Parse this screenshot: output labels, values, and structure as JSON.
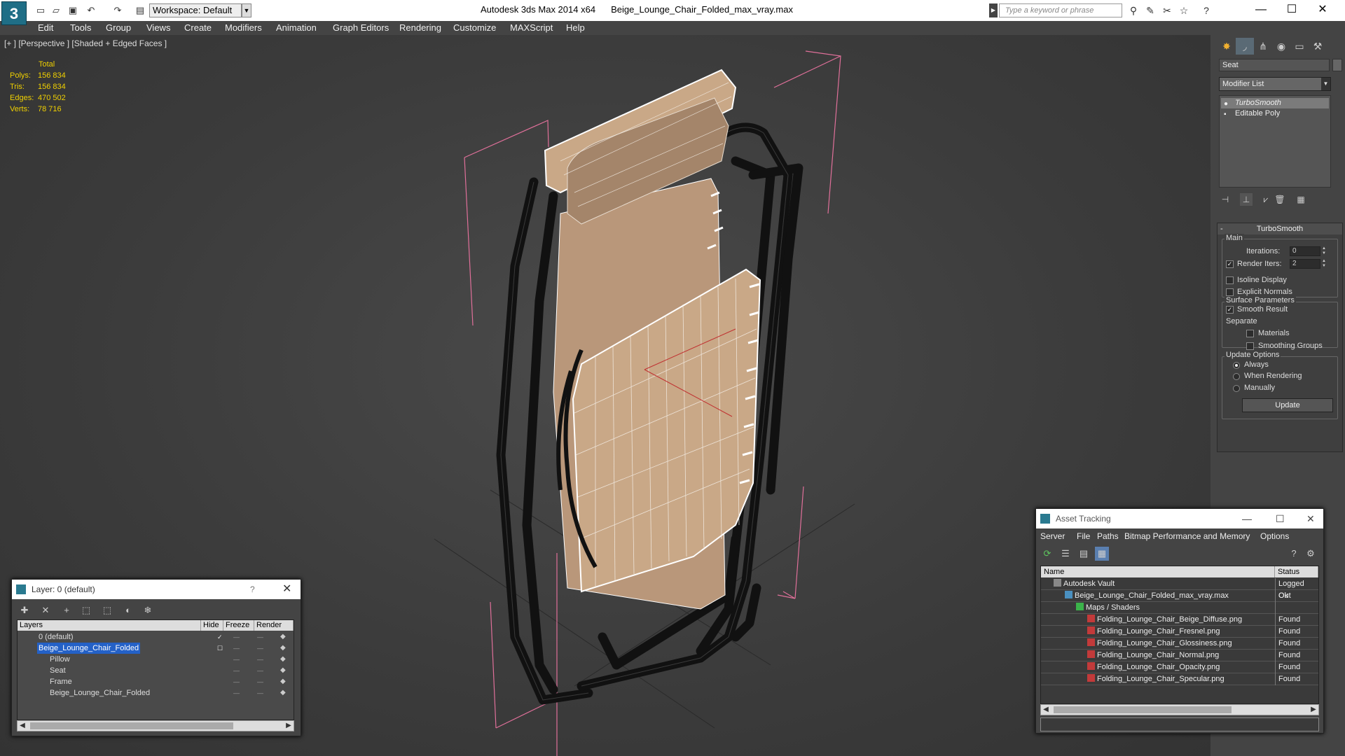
{
  "app": {
    "window_title": "Autodesk 3ds Max  2014 x64",
    "file_title": "Beige_Lounge_Chair_Folded_max_vray.max",
    "logo": "3",
    "workspace": "Workspace: Default",
    "search_placeholder": "Type a keyword or phrase"
  },
  "menu": [
    "Edit",
    "Tools",
    "Group",
    "Views",
    "Create",
    "Modifiers",
    "Animation",
    "Graph Editors",
    "Rendering",
    "Customize",
    "MAXScript",
    "Help"
  ],
  "viewport": {
    "label": "[+ ] [Perspective ] [Shaded + Edged Faces ]",
    "stats": {
      "header": "Total",
      "rows": [
        {
          "label": "Polys:",
          "value": "156 834"
        },
        {
          "label": "Tris:",
          "value": "156 834"
        },
        {
          "label": "Edges:",
          "value": "470 502"
        },
        {
          "label": "Verts:",
          "value": "78 716"
        }
      ]
    }
  },
  "command_panel": {
    "object_name": "Seat",
    "modifier_list": "Modifier List",
    "stack": [
      {
        "label": "TurboSmooth",
        "selected": true
      },
      {
        "label": "Editable Poly",
        "selected": false
      }
    ],
    "rollout_title": "TurboSmooth",
    "main_group": "Main",
    "iterations_label": "Iterations:",
    "iterations_value": "0",
    "render_iters_label": "Render Iters:",
    "render_iters_value": "2",
    "isoline_label": "Isoline Display",
    "explicit_normals_label": "Explicit Normals",
    "surface_group": "Surface Parameters",
    "smooth_result_label": "Smooth Result",
    "separate_label": "Separate",
    "materials_label": "Materials",
    "smoothing_groups_label": "Smoothing Groups",
    "update_group": "Update Options",
    "always_label": "Always",
    "when_rendering_label": "When Rendering",
    "manually_label": "Manually",
    "update_button": "Update"
  },
  "layer_window": {
    "title": "Layer: 0 (default)",
    "help": "?",
    "columns": [
      "Layers",
      "Hide",
      "Freeze",
      "Render"
    ],
    "rows": [
      {
        "name": "0 (default)",
        "indent": 1,
        "selected": false
      },
      {
        "name": "Beige_Lounge_Chair_Folded",
        "indent": 1,
        "selected": true
      },
      {
        "name": "Pillow",
        "indent": 2,
        "selected": false
      },
      {
        "name": "Seat",
        "indent": 2,
        "selected": false
      },
      {
        "name": "Frame",
        "indent": 2,
        "selected": false
      },
      {
        "name": "Beige_Lounge_Chair_Folded",
        "indent": 2,
        "selected": false
      }
    ]
  },
  "asset_window": {
    "title": "Asset Tracking",
    "menu": [
      "Server",
      "File",
      "Paths",
      "Bitmap Performance and Memory",
      "Options"
    ],
    "columns": [
      "Name",
      "Status"
    ],
    "rows": [
      {
        "name": "Autodesk Vault",
        "status": "Logged Out",
        "indent": 1
      },
      {
        "name": "Beige_Lounge_Chair_Folded_max_vray.max",
        "status": "Ok",
        "indent": 2
      },
      {
        "name": "Maps / Shaders",
        "status": "",
        "indent": 3
      },
      {
        "name": "Folding_Lounge_Chair_Beige_Diffuse.png",
        "status": "Found",
        "indent": 4
      },
      {
        "name": "Folding_Lounge_Chair_Fresnel.png",
        "status": "Found",
        "indent": 4
      },
      {
        "name": "Folding_Lounge_Chair_Glossiness.png",
        "status": "Found",
        "indent": 4
      },
      {
        "name": "Folding_Lounge_Chair_Normal.png",
        "status": "Found",
        "indent": 4
      },
      {
        "name": "Folding_Lounge_Chair_Opacity.png",
        "status": "Found",
        "indent": 4
      },
      {
        "name": "Folding_Lounge_Chair_Specular.png",
        "status": "Found",
        "indent": 4
      }
    ]
  },
  "colors": {
    "stats_text": "#f0d000",
    "selection": "#2461c7",
    "fabric": "#c9a887",
    "bbox": "#e0709a"
  }
}
